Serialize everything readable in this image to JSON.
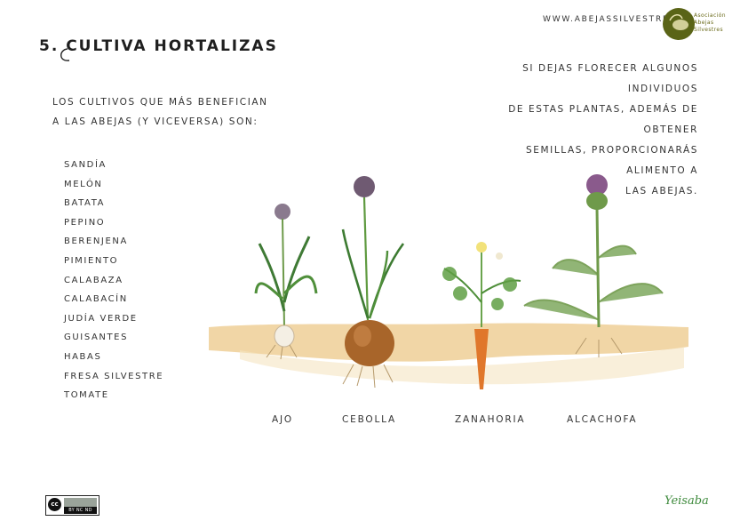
{
  "header": {
    "title": "5. Cultiva hortalizas",
    "website": "www.abejassilvestres.es",
    "logo_text": [
      "Asociación",
      "Abejas",
      "Silvestres"
    ]
  },
  "intro": {
    "line1": "Los cultivos que más benefician",
    "line2": "a las abejas (y viceversa) son:"
  },
  "note": {
    "line1": "Si dejas florecer algunos individuos",
    "line2": "de estas plantas, además de obtener",
    "line3": "semillas, proporcionarás alimento a",
    "line4": "las abejas."
  },
  "crops": [
    "Sandía",
    "Melón",
    "Batata",
    "Pepino",
    "Berenjena",
    "Pimiento",
    "Calabaza",
    "Calabacín",
    "Judía verde",
    "Guisantes",
    "Habas",
    "Fresa silvestre",
    "Tomate"
  ],
  "plants": {
    "ajo": "Ajo",
    "cebolla": "Cebolla",
    "zanahoria": "Zanahoria",
    "alcachofa": "Alcachofa"
  },
  "license": {
    "cc": "cc",
    "terms": "BY NC ND"
  },
  "signature": "Yeisaba",
  "colors": {
    "soil": "#e9c58a",
    "leaf_green": "#4f8f3a",
    "onion_bulb": "#a8652a",
    "carrot": "#e0772b",
    "artichoke_flower": "#8a5a8c",
    "logo": "#5a6417"
  }
}
